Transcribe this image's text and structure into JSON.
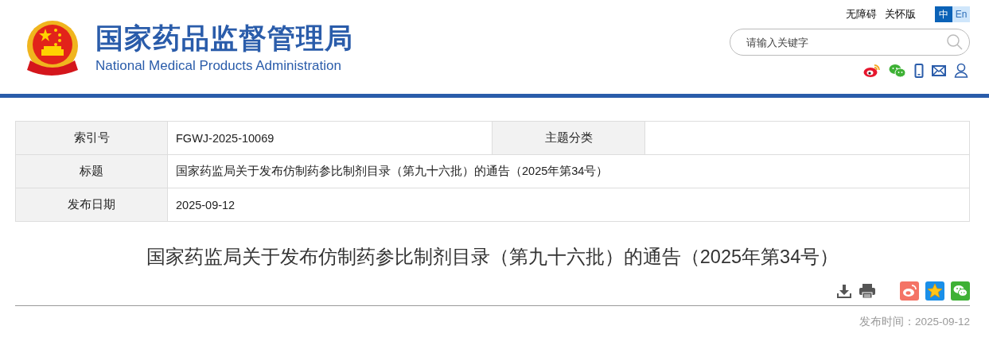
{
  "header": {
    "title_cn": "国家药品监督管理局",
    "title_en": "National Medical Products Administration",
    "links": [
      "无障碍",
      "关怀版"
    ],
    "languages": [
      {
        "label": "中",
        "selected": true
      },
      {
        "label": "En",
        "selected": false
      }
    ],
    "search": {
      "placeholder": "请输入关键字"
    }
  },
  "meta_table": {
    "rows": [
      {
        "label": "索引号",
        "value": "FGWJ-2025-10069",
        "label_2": "主题分类"
      },
      {
        "label": "标题",
        "value": "国家药监局关于发布仿制药参比制剂目录（第九十六批）的通告（2025年第34号）"
      },
      {
        "label": "发布日期",
        "value": "2025-09-12"
      }
    ]
  },
  "article": {
    "title": "国家药监局关于发布仿制药参比制剂目录（第九十六批）的通告（2025年第34号）",
    "publish_time": "发布时间：2025-09-12"
  }
}
